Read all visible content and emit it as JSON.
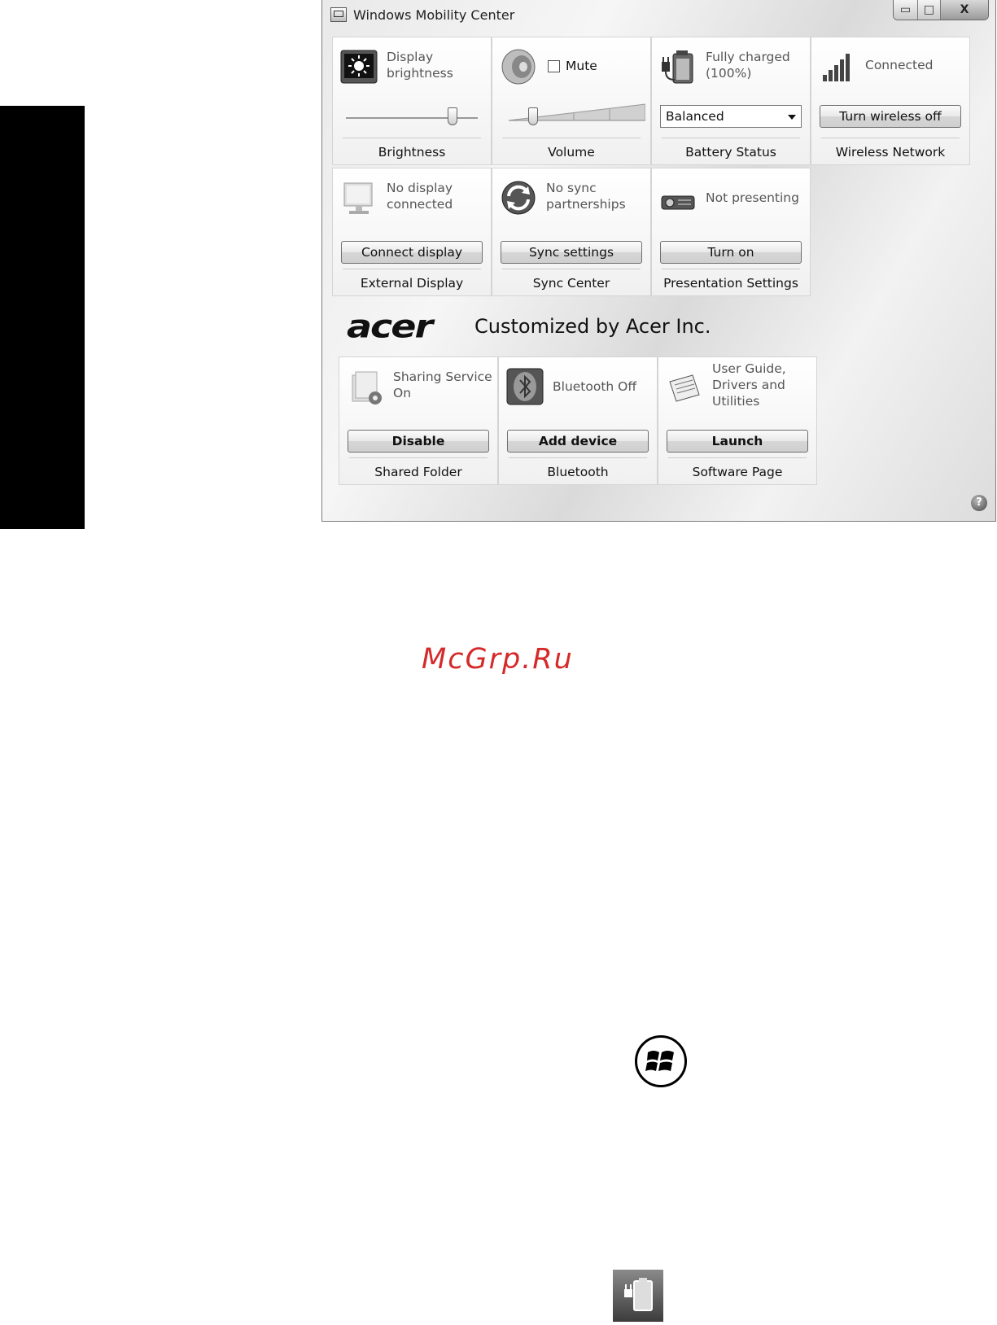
{
  "window": {
    "title": "Windows Mobility Center",
    "controls": {
      "minimize": "▭",
      "maximize": "□",
      "close": "X"
    }
  },
  "tiles": {
    "brightness": {
      "status": "Display brightness",
      "label": "Brightness",
      "icon": "display-brightness-icon",
      "level": 0.8
    },
    "volume": {
      "mute_label": "Mute",
      "mute_checked": false,
      "label": "Volume",
      "icon": "speaker-icon",
      "level": 0.18
    },
    "battery": {
      "status": "Fully charged (100%)",
      "plan": "Balanced",
      "label": "Battery Status",
      "icon": "battery-icon"
    },
    "wireless": {
      "status": "Connected",
      "button": "Turn wireless off",
      "label": "Wireless Network",
      "icon": "signal-bars-icon"
    },
    "external_display": {
      "status": "No display connected",
      "button": "Connect display",
      "label": "External Display",
      "icon": "monitor-icon"
    },
    "sync": {
      "status": "No sync partnerships",
      "button": "Sync settings",
      "label": "Sync Center",
      "icon": "sync-icon"
    },
    "presentation": {
      "status": "Not presenting",
      "button": "Turn on",
      "label": "Presentation Settings",
      "icon": "projector-icon"
    }
  },
  "acer": {
    "logo": "acer",
    "customized": "Customized by Acer Inc.",
    "tiles": {
      "shared_folder": {
        "status": "Sharing Service On",
        "button": "Disable",
        "label": "Shared Folder",
        "icon": "shared-folder-icon"
      },
      "bluetooth": {
        "status": "Bluetooth Off",
        "button": "Add device",
        "label": "Bluetooth",
        "icon": "bluetooth-icon"
      },
      "software": {
        "status": "User Guide, Drivers and Utilities",
        "button": "Launch",
        "label": "Software Page",
        "icon": "software-page-icon"
      }
    }
  },
  "help": "?",
  "watermark": "McGrp.Ru"
}
